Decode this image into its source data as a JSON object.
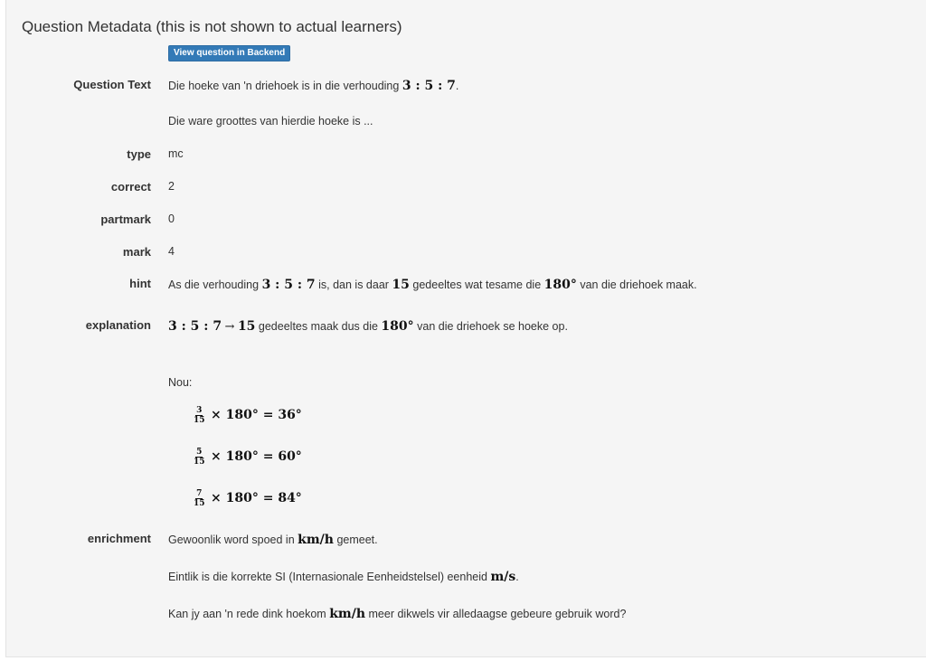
{
  "title": "Question Metadata (this is not shown to actual learners)",
  "backend_button": "View question in Backend",
  "question_text": {
    "label": "Question Text",
    "line1_pre": "Die hoeke van 'n driehoek is in die verhouding",
    "ratio": "3 : 5 : 7",
    "line1_post": ".",
    "line2": "Die ware groottes van hierdie hoeke is ..."
  },
  "type": {
    "label": "type",
    "value": "mc"
  },
  "correct": {
    "label": "correct",
    "value": "2"
  },
  "partmark": {
    "label": "partmark",
    "value": "0"
  },
  "mark": {
    "label": "mark",
    "value": "4"
  },
  "hint": {
    "label": "hint",
    "t1": "As die verhouding",
    "ratio": "3 : 5 : 7",
    "t2": "is, dan is daar",
    "parts": "15",
    "t3": "gedeeltes wat tesame die",
    "angle": "180°",
    "t4": "van die driehoek maak."
  },
  "explanation": {
    "label": "explanation",
    "ratio": "3 : 5 : 7",
    "arrow": "→",
    "parts": "15",
    "t1": "gedeeltes maak dus die",
    "angle": "180°",
    "t2": "van die driehoek se hoeke op.",
    "nou": "Nou:",
    "equations": [
      {
        "num": "3",
        "den": "15",
        "rest": "× 180° = 36°"
      },
      {
        "num": "5",
        "den": "15",
        "rest": "× 180° = 60°"
      },
      {
        "num": "7",
        "den": "15",
        "rest": "× 180° = 84°"
      }
    ]
  },
  "enrichment": {
    "label": "enrichment",
    "l1_pre": "Gewoonlik word spoed in",
    "kmh": "km/h",
    "l1_post": "gemeet.",
    "l2_pre": "Eintlik is die korrekte SI (Internasionale Eenheidstelsel) eenheid",
    "ms": "m/s",
    "l2_post": ".",
    "l3_pre": "Kan jy aan 'n rede dink hoekom",
    "l3_kmh": "km/h",
    "l3_post": "meer dikwels vir alledaagse gebeure gebruik word?"
  }
}
